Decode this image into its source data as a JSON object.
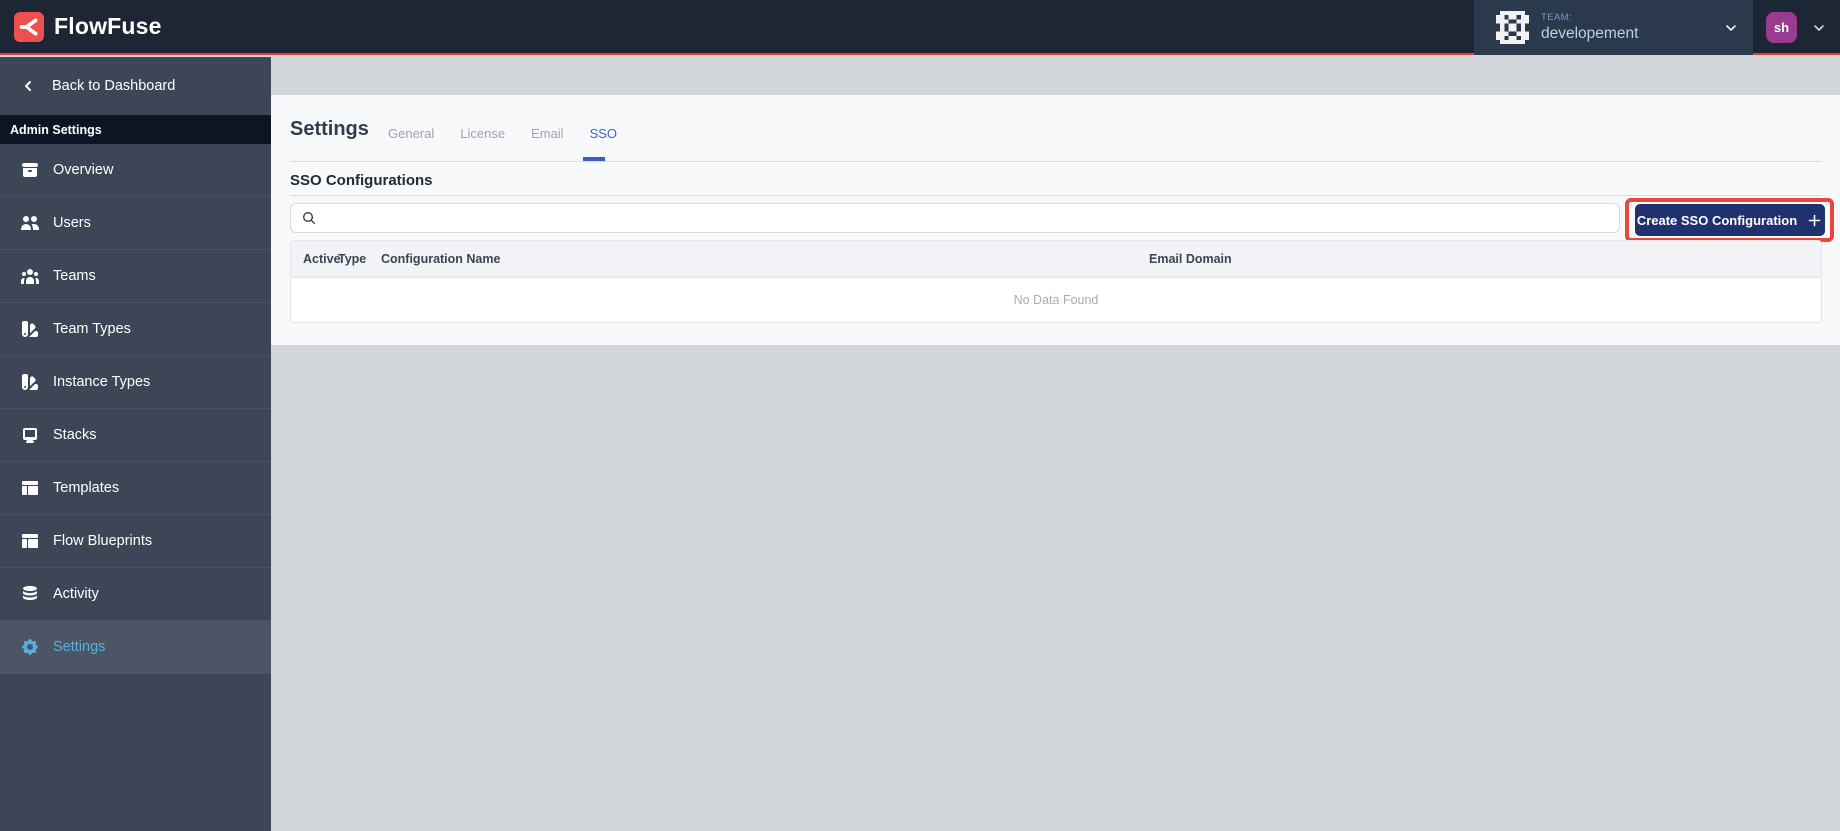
{
  "header": {
    "brand": "FlowFuse",
    "team": {
      "label": "TEAM:",
      "name": "developement"
    },
    "user": {
      "initials": "sh"
    }
  },
  "sidebar": {
    "back_label": "Back to Dashboard",
    "section_label": "Admin Settings",
    "items": [
      {
        "label": "Overview",
        "icon": "archive-icon",
        "active": false
      },
      {
        "label": "Users",
        "icon": "users-icon",
        "active": false
      },
      {
        "label": "Teams",
        "icon": "user-group-icon",
        "active": false
      },
      {
        "label": "Team Types",
        "icon": "color-swatch-icon",
        "active": false
      },
      {
        "label": "Instance Types",
        "icon": "color-swatch-icon",
        "active": false
      },
      {
        "label": "Stacks",
        "icon": "desktop-icon",
        "active": false
      },
      {
        "label": "Templates",
        "icon": "template-icon",
        "active": false
      },
      {
        "label": "Flow Blueprints",
        "icon": "template-icon",
        "active": false
      },
      {
        "label": "Activity",
        "icon": "database-icon",
        "active": false
      },
      {
        "label": "Settings",
        "icon": "cog-icon",
        "active": true
      }
    ]
  },
  "main": {
    "title": "Settings",
    "tabs": [
      {
        "label": "General",
        "active": false
      },
      {
        "label": "License",
        "active": false
      },
      {
        "label": "Email",
        "active": false
      },
      {
        "label": "SSO",
        "active": true
      }
    ],
    "section_title": "SSO Configurations",
    "search": {
      "value": "",
      "placeholder": ""
    },
    "create_button": {
      "label": "Create SSO Configuration"
    },
    "table": {
      "columns": [
        "Active",
        "Type",
        "Configuration Name",
        "Email Domain"
      ],
      "rows": [],
      "empty_text": "No Data Found"
    }
  },
  "colors": {
    "header_bg": "#1c2634",
    "accent_red": "#e0423b",
    "logo_red": "#ee5050",
    "sidebar_bg": "#3d4656",
    "sidebar_active_bg": "#4c5566",
    "active_blue": "#58afdc",
    "tab_active_blue": "#3e63d2",
    "button_navy": "#203170",
    "annotation_red": "#e8473b",
    "page_gray": "#d2d5da",
    "panel_bg": "#f8f9fb"
  }
}
